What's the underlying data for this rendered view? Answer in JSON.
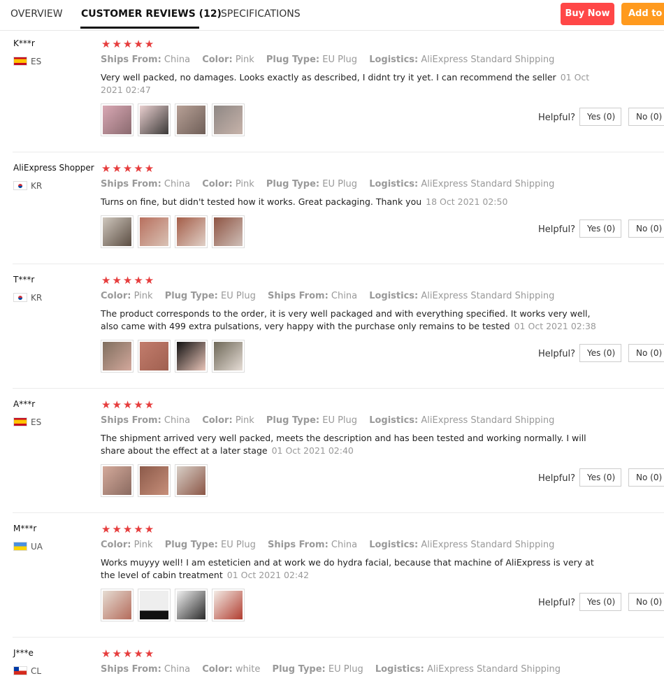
{
  "tabs": [
    {
      "label": "OVERVIEW"
    },
    {
      "label": "CUSTOMER REVIEWS (12)"
    },
    {
      "label": "SPECIFICATIONS"
    }
  ],
  "buttons": {
    "buy_now": "Buy Now",
    "add_to_cart": "Add to C"
  },
  "helpful_label": "Helpful?",
  "reviews": [
    {
      "user": "K***r",
      "country": "ES",
      "stars": "★★★★★",
      "attrs": [
        {
          "k": "Ships From:",
          "v": "China"
        },
        {
          "k": "Color:",
          "v": "Pink"
        },
        {
          "k": "Plug Type:",
          "v": "EU Plug"
        },
        {
          "k": "Logistics:",
          "v": "AliExpress Standard Shipping"
        }
      ],
      "text": "Very well packed, no damages. Looks exactly as described, I didnt try it yet. I can recommend the seller",
      "date": "01 Oct 2021 02:47",
      "yes": "Yes (0)",
      "no": "No (0)"
    },
    {
      "user": "AliExpress Shopper",
      "country": "KR",
      "stars": "★★★★★",
      "attrs": [
        {
          "k": "Ships From:",
          "v": "China"
        },
        {
          "k": "Color:",
          "v": "Pink"
        },
        {
          "k": "Plug Type:",
          "v": "EU Plug"
        },
        {
          "k": "Logistics:",
          "v": "AliExpress Standard Shipping"
        }
      ],
      "text": "Turns on fine, but didn't tested how it works. Great packaging. Thank you",
      "date": "18 Oct 2021 02:50",
      "yes": "Yes (0)",
      "no": "No (0)"
    },
    {
      "user": "T***r",
      "country": "KR",
      "stars": "★★★★★",
      "attrs": [
        {
          "k": "Color:",
          "v": "Pink"
        },
        {
          "k": "Plug Type:",
          "v": "EU Plug"
        },
        {
          "k": "Ships From:",
          "v": "China"
        },
        {
          "k": "Logistics:",
          "v": "AliExpress Standard Shipping"
        }
      ],
      "text": "The product corresponds to the order, it is very well packaged and with everything specified. It works very well, also came with 499 extra pulsations, very happy with the purchase only remains to be tested",
      "date": "01 Oct 2021 02:38",
      "yes": "Yes (0)",
      "no": "No (0)"
    },
    {
      "user": "A***r",
      "country": "ES",
      "stars": "★★★★★",
      "attrs": [
        {
          "k": "Ships From:",
          "v": "China"
        },
        {
          "k": "Color:",
          "v": "Pink"
        },
        {
          "k": "Plug Type:",
          "v": "EU Plug"
        },
        {
          "k": "Logistics:",
          "v": "AliExpress Standard Shipping"
        }
      ],
      "text": "The shipment arrived very well packed, meets the description and has been tested and working normally. I will share about the effect at a later stage",
      "date": "01 Oct 2021 02:40",
      "yes": "Yes (0)",
      "no": "No (0)"
    },
    {
      "user": "M***r",
      "country": "UA",
      "stars": "★★★★★",
      "attrs": [
        {
          "k": "Color:",
          "v": "Pink"
        },
        {
          "k": "Plug Type:",
          "v": "EU Plug"
        },
        {
          "k": "Ships From:",
          "v": "China"
        },
        {
          "k": "Logistics:",
          "v": "AliExpress Standard Shipping"
        }
      ],
      "text": "Works muyyy well! I am esteticien and at work we do hydra facial, because that machine of AliExpress is very at the level of cabin treatment",
      "date": "01 Oct 2021 02:42",
      "yes": "Yes (0)",
      "no": "No (0)"
    },
    {
      "user": "J***e",
      "country": "CL",
      "stars": "★★★★★",
      "attrs": [
        {
          "k": "Ships From:",
          "v": "China"
        },
        {
          "k": "Color:",
          "v": "white"
        },
        {
          "k": "Plug Type:",
          "v": "EU Plug"
        },
        {
          "k": "Logistics:",
          "v": "AliExpress Standard Shipping"
        }
      ]
    }
  ]
}
